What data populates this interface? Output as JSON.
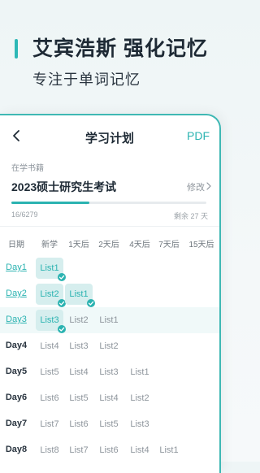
{
  "promo": {
    "title": "艾宾浩斯 强化记忆",
    "subtitle": "专注于单词记忆"
  },
  "nav": {
    "title": "学习计划",
    "pdf_label": "PDF"
  },
  "book": {
    "section_label": "在学书籍",
    "name": "2023硕士研究生考试",
    "edit_label": "修改",
    "progress_text": "16/6279",
    "progress_fraction": 0.0025,
    "remaining_text": "剩余 27 天"
  },
  "columns": [
    "日期",
    "新学",
    "1天后",
    "2天后",
    "4天后",
    "7天后",
    "15天后"
  ],
  "rows": [
    {
      "day": "Day1",
      "cells": [
        "List1",
        "",
        "",
        "",
        "",
        ""
      ],
      "done": [
        true,
        false,
        false,
        false,
        false,
        false
      ],
      "link": true,
      "highlight": false
    },
    {
      "day": "Day2",
      "cells": [
        "List2",
        "List1",
        "",
        "",
        "",
        ""
      ],
      "done": [
        true,
        true,
        false,
        false,
        false,
        false
      ],
      "link": true,
      "highlight": false
    },
    {
      "day": "Day3",
      "cells": [
        "List3",
        "List2",
        "List1",
        "",
        "",
        ""
      ],
      "done": [
        true,
        false,
        false,
        false,
        false,
        false
      ],
      "link": true,
      "highlight": true
    },
    {
      "day": "Day4",
      "cells": [
        "List4",
        "List3",
        "List2",
        "",
        "",
        ""
      ],
      "done": [
        false,
        false,
        false,
        false,
        false,
        false
      ],
      "link": false,
      "highlight": false
    },
    {
      "day": "Day5",
      "cells": [
        "List5",
        "List4",
        "List3",
        "List1",
        "",
        ""
      ],
      "done": [
        false,
        false,
        false,
        false,
        false,
        false
      ],
      "link": false,
      "highlight": false
    },
    {
      "day": "Day6",
      "cells": [
        "List6",
        "List5",
        "List4",
        "List2",
        "",
        ""
      ],
      "done": [
        false,
        false,
        false,
        false,
        false,
        false
      ],
      "link": false,
      "highlight": false
    },
    {
      "day": "Day7",
      "cells": [
        "List7",
        "List6",
        "List5",
        "List3",
        "",
        ""
      ],
      "done": [
        false,
        false,
        false,
        false,
        false,
        false
      ],
      "link": false,
      "highlight": false
    },
    {
      "day": "Day8",
      "cells": [
        "List8",
        "List7",
        "List6",
        "List4",
        "List1",
        ""
      ],
      "done": [
        false,
        false,
        false,
        false,
        false,
        false
      ],
      "link": false,
      "highlight": false
    }
  ],
  "icons": {
    "back": "chevron-left-icon",
    "edit": "chevron-right-icon",
    "check": "check-icon"
  },
  "colors": {
    "accent": "#2bb3b1",
    "done_bg": "#d6eeee",
    "title": "#1e2a35"
  }
}
